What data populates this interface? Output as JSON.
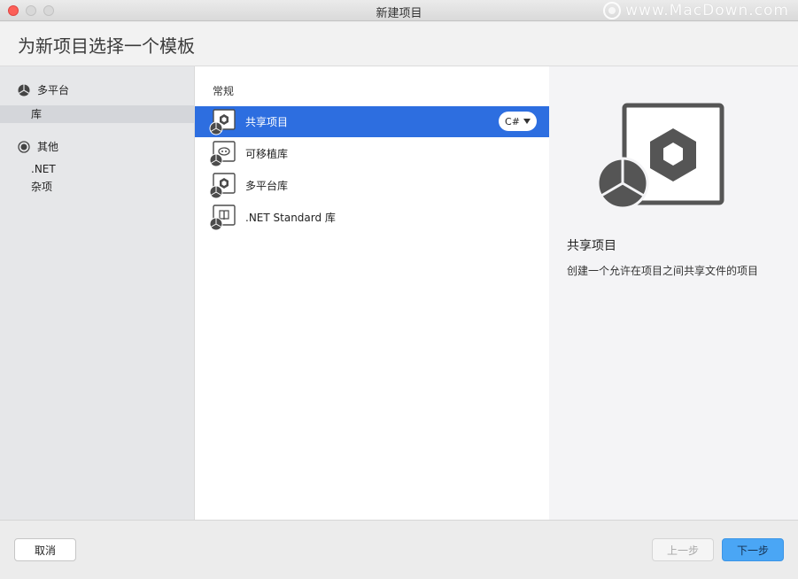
{
  "window": {
    "title": "新建项目",
    "watermark": "www.MacDown.com"
  },
  "header": {
    "title": "为新项目选择一个模板"
  },
  "sidebar": {
    "categories": [
      {
        "label": "多平台",
        "icon": "multiplatform-icon",
        "items": [
          {
            "label": "库",
            "selected": true
          }
        ]
      },
      {
        "label": "其他",
        "icon": "other-icon",
        "items": [
          {
            "label": ".NET"
          },
          {
            "label": "杂项"
          }
        ]
      }
    ]
  },
  "templates": {
    "section_title": "常规",
    "items": [
      {
        "label": "共享项目",
        "icon": "shared-project-icon",
        "selected": true,
        "language": "C#"
      },
      {
        "label": "可移植库",
        "icon": "portable-library-icon"
      },
      {
        "label": "多平台库",
        "icon": "multiplatform-library-icon"
      },
      {
        "label": ".NET Standard 库",
        "icon": "netstandard-library-icon"
      }
    ]
  },
  "detail": {
    "title": "共享项目",
    "description": "创建一个允许在项目之间共享文件的项目",
    "icon": "shared-project-large-icon"
  },
  "footer": {
    "cancel": "取消",
    "previous": "上一步",
    "next": "下一步"
  },
  "colors": {
    "selection": "#2d6ee0",
    "primary_button": "#4aa6f5",
    "close_button": "#fc5f57"
  }
}
